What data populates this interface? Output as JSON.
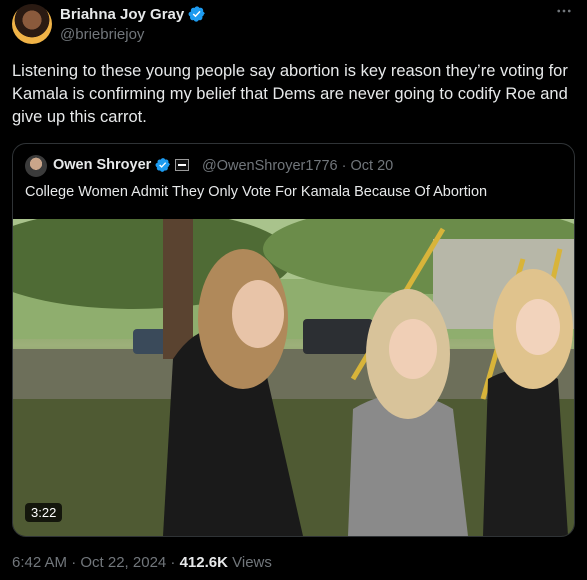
{
  "author": {
    "name": "Briahna Joy Gray",
    "handle": "@briebriejoy"
  },
  "tweet": {
    "text": "Listening to these young people say abortion is key reason they’re voting for Kamala is confirming my belief that Dems are never going to codify Roe and give up this carrot."
  },
  "quoted": {
    "name": "Owen Shroyer",
    "meta": "@OwenShroyer1776 · Oct 20",
    "text": "College Women Admit They Only Vote For Kamala Because Of Abortion",
    "video_duration": "3:22"
  },
  "footer": {
    "datetime": "6:42 AM · Oct 22, 2024 · ",
    "views_count": "412.6K",
    "views_label": " Views"
  },
  "icons": {
    "verified_color": "#1d9bf0",
    "more": "more-icon"
  },
  "colors": {
    "background": "#000000",
    "text": "#e7e9ea",
    "muted": "#71767b",
    "border": "#2f3336"
  }
}
